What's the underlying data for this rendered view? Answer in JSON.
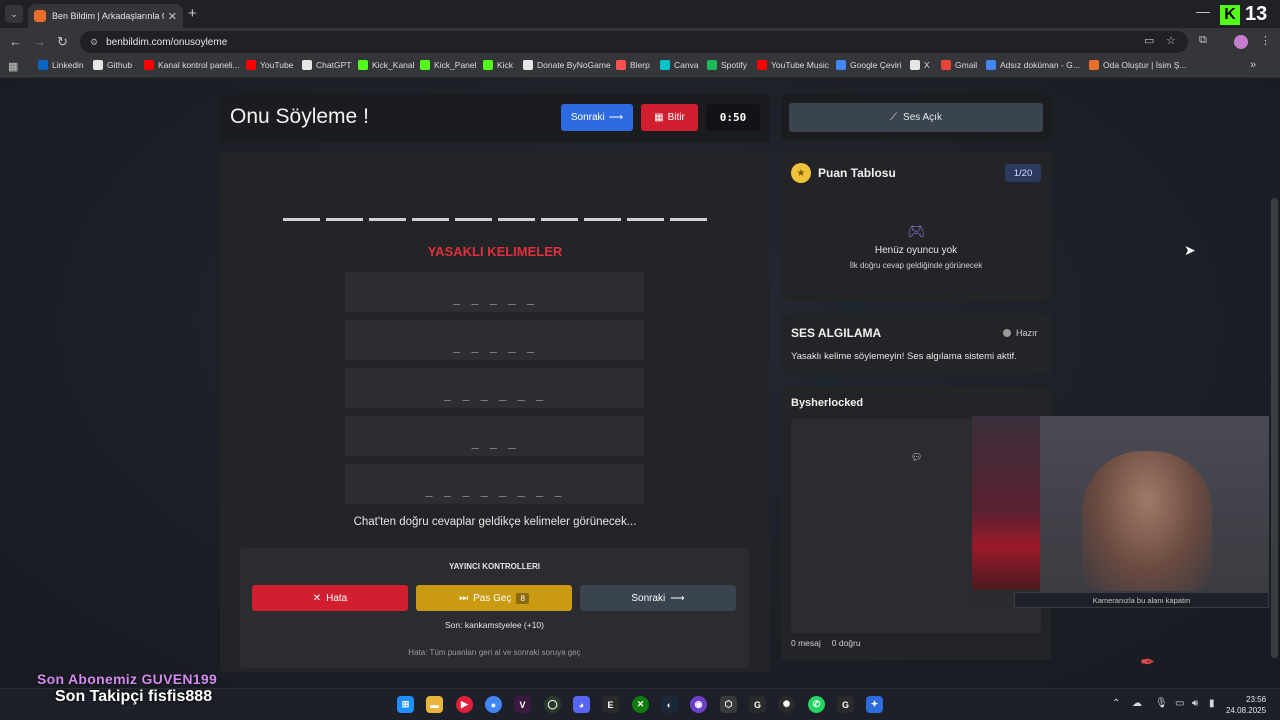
{
  "browser": {
    "tab_title": "Ben Bildim | Arkadaşlarınla Onl",
    "url": "benbildim.com/onusoyleme",
    "kick_count": "13"
  },
  "bookmarks": [
    {
      "label": "Linkedin",
      "color": "#0a66c2"
    },
    {
      "label": "Github",
      "color": "#e6e6e6"
    },
    {
      "label": "Kanal kontrol paneli...",
      "color": "#ff0000"
    },
    {
      "label": "YouTube",
      "color": "#ff0000"
    },
    {
      "label": "ChatGPT",
      "color": "#e6e6e6"
    },
    {
      "label": "Kick_Kanal",
      "color": "#53fc18"
    },
    {
      "label": "Kick_Panel",
      "color": "#53fc18"
    },
    {
      "label": "Kick",
      "color": "#53fc18"
    },
    {
      "label": "Donate ByNoGame",
      "color": "#e6e6e6"
    },
    {
      "label": "Blerp",
      "color": "#ff4f4f"
    },
    {
      "label": "Canva",
      "color": "#00c4cc"
    },
    {
      "label": "Spotify",
      "color": "#1db954"
    },
    {
      "label": "YouTube Music",
      "color": "#ff0000"
    },
    {
      "label": "Google Çeviri",
      "color": "#4285f4"
    },
    {
      "label": "X",
      "color": "#e6e6e6"
    },
    {
      "label": "Gmail",
      "color": "#ea4335"
    },
    {
      "label": "Adsız doküman - G...",
      "color": "#4285f4"
    },
    {
      "label": "Oda Oluştur | İsim Ş...",
      "color": "#e8702a"
    }
  ],
  "game": {
    "title": "Onu Söyleme !",
    "next_label": "Sonraki",
    "end_label": "Bitir",
    "timer": "0:50",
    "forbidden_title": "YASAKLI KELIMELER",
    "forbidden_words": [
      "_ _ _ _ _",
      "_ _ _ _ _",
      "_ _ _ _ _ _",
      "_ _ _",
      "_ _ _ _ _ _ _ _"
    ],
    "chat_hint": "Chat'ten doğru cevaplar geldikçe kelimeler görünecek..."
  },
  "controls": {
    "title": "YAYINCI KONTROLLERI",
    "error_label": "Hata",
    "pass_label": "Pas Geç",
    "pass_count": "8",
    "next_label": "Sonraki",
    "last_line": "Son: kankamstyelee (+10)",
    "help_line": "Hata: Tüm puanları geri al ve sonraki soruya geç"
  },
  "sound": {
    "label": "Ses Açık"
  },
  "scoreboard": {
    "title": "Puan Tablosu",
    "badge": "1/20",
    "empty_title": "Henüz oyuncu yok",
    "empty_sub": "İlk doğru cevap geldiğinde görünecek"
  },
  "voice": {
    "title": "SES ALGILAMA",
    "status": "Hazır",
    "description": "Yasaklı kelime söylemeyin! Ses algılama sistemi aktif."
  },
  "chat": {
    "title": "Bysherlocked",
    "messages": "0 mesaj",
    "correct": "0 doğru"
  },
  "webcam": {
    "caption": "Kameranızla bu alanı kapatın"
  },
  "overlay": {
    "subscriber": "Son Abonemiz GUVEN199",
    "follower": "Son Takipçi fisfis888"
  },
  "taskbar": {
    "time": "23:56",
    "date": "24.08.2025"
  }
}
